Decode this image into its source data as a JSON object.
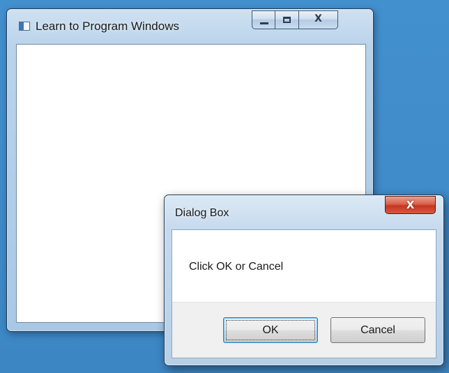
{
  "main_window": {
    "title": "Learn to Program Windows",
    "caption_buttons": {
      "minimize_icon": "minimize-icon",
      "maximize_icon": "maximize-icon",
      "close_glyph": "X"
    }
  },
  "dialog": {
    "title": "Dialog Box",
    "close_glyph": "X",
    "message": "Click OK or Cancel",
    "buttons": {
      "ok": "OK",
      "cancel": "Cancel"
    }
  },
  "colors": {
    "desktop": "#3f8ac8",
    "dialog_close": "#c4361f",
    "focused_button_border": "#3c7fb1"
  }
}
